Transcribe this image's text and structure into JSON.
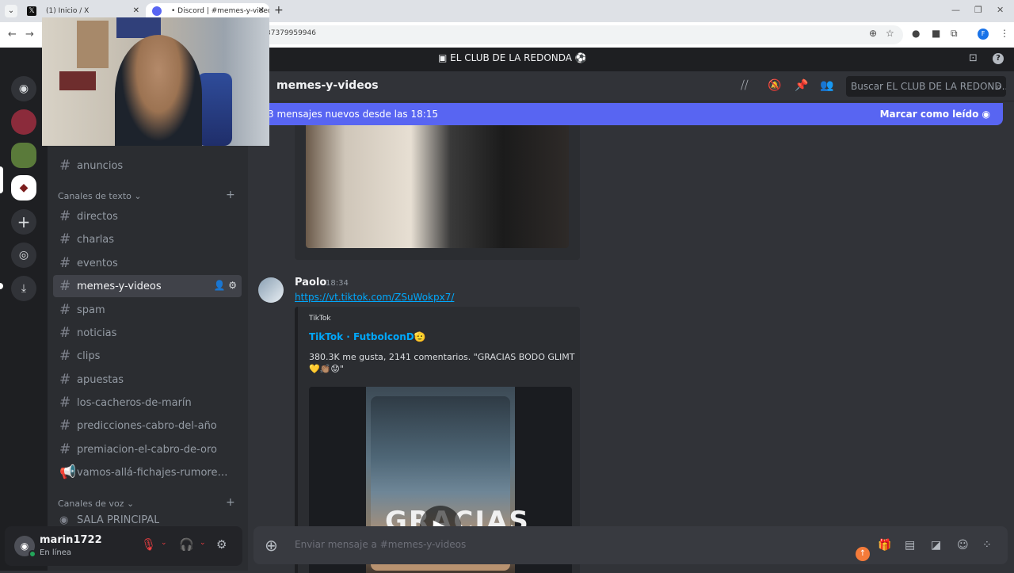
{
  "browser": {
    "tabs": [
      {
        "title": "(1) Inicio / X",
        "favicon": "x-logo-icon"
      },
      {
        "title": "• Discord | #memes-y-videos | E",
        "favicon": "discord-icon"
      }
    ],
    "url": "37379959946"
  },
  "server": {
    "title": "EL CLUB DE LA REDONDA"
  },
  "sidebar": {
    "top_channel": "anuncios",
    "text_category": "Canales de texto",
    "channels": [
      {
        "name": "directos",
        "type": "text"
      },
      {
        "name": "charlas",
        "type": "text"
      },
      {
        "name": "eventos",
        "type": "text"
      },
      {
        "name": "memes-y-videos",
        "type": "text",
        "active": true
      },
      {
        "name": "spam",
        "type": "text"
      },
      {
        "name": "noticias",
        "type": "text"
      },
      {
        "name": "clips",
        "type": "text"
      },
      {
        "name": "apuestas",
        "type": "text"
      },
      {
        "name": "los-cacheros-de-marín",
        "type": "text"
      },
      {
        "name": "predicciones-cabro-del-año",
        "type": "text"
      },
      {
        "name": "premiacion-el-cabro-de-oro",
        "type": "text"
      },
      {
        "name": "vamos-allá-fichajes-rumores-n...",
        "type": "announcement"
      }
    ],
    "voice_category": "Canales de voz",
    "voice_channel": "SALA PRINCIPAL"
  },
  "user": {
    "name": "marin1722",
    "status": "En línea"
  },
  "channel_header": {
    "name": "memes-y-videos",
    "search_placeholder": "Buscar EL CLUB DE LA REDOND..."
  },
  "new_messages_bar": {
    "text": "3 mensajes nuevos desde las 18:15",
    "action": "Marcar como leído"
  },
  "message": {
    "author": "Paolo",
    "time": "18:34",
    "link": "https://vt.tiktok.com/ZSuWokpx7/",
    "embed": {
      "provider": "TikTok",
      "title": "TikTok · FutbolconD🫡",
      "description": "380.3K me gusta, 2141 comentarios. \"GRACIAS BODO GLIMT 💛👏🏽😟\"",
      "video_overlay_text": "GRACIAS"
    }
  },
  "composer": {
    "placeholder": "Enviar mensaje a #memes-y-videos"
  },
  "colors": {
    "accent": "#5865f2",
    "link": "#00a8fc",
    "online": "#23a55a",
    "muted_red": "#f23f42"
  }
}
